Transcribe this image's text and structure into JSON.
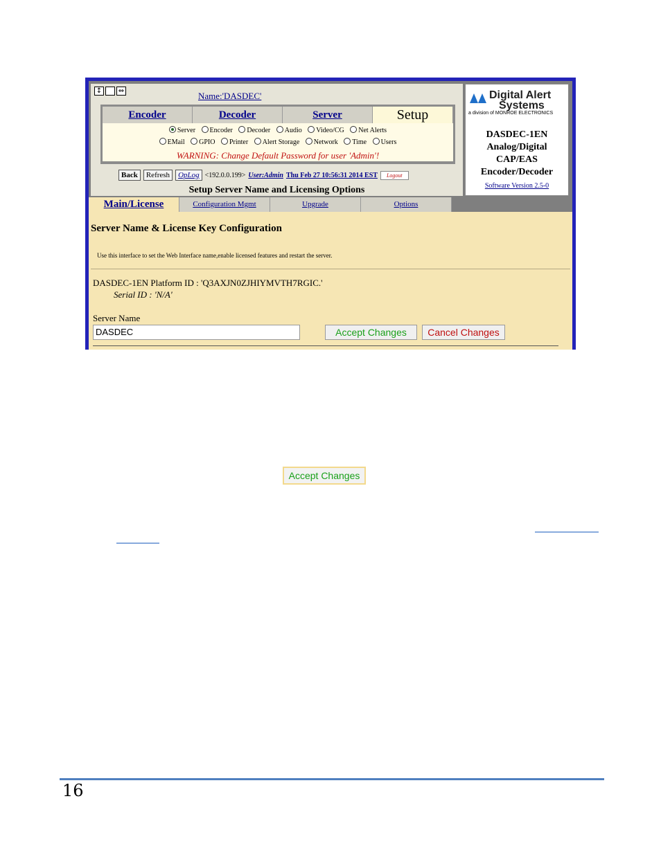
{
  "screenshot": {
    "window_icons": [
      "↕",
      "",
      "⇔"
    ],
    "name_link": "Name:'DASDEC'",
    "main_tabs": [
      {
        "label": "Encoder",
        "active": false
      },
      {
        "label": "Decoder",
        "active": false
      },
      {
        "label": "Server",
        "active": false
      },
      {
        "label": "Setup",
        "active": true
      }
    ],
    "radio_row1": [
      {
        "label": "Server",
        "selected": true
      },
      {
        "label": "Encoder",
        "selected": false
      },
      {
        "label": "Decoder",
        "selected": false
      },
      {
        "label": "Audio",
        "selected": false
      },
      {
        "label": "Video/CG",
        "selected": false
      },
      {
        "label": "Net Alerts",
        "selected": false
      }
    ],
    "radio_row2": [
      {
        "label": "EMail",
        "selected": false
      },
      {
        "label": "GPIO",
        "selected": false
      },
      {
        "label": "Printer",
        "selected": false
      },
      {
        "label": "Alert Storage",
        "selected": false
      },
      {
        "label": "Network",
        "selected": false
      },
      {
        "label": "Time",
        "selected": false
      },
      {
        "label": "Users",
        "selected": false
      }
    ],
    "warning": "WARNING: Change Default Password for user 'Admin'!",
    "toolbar": {
      "back": "Back",
      "refresh": "Refresh",
      "oplog": "OpLog",
      "ip": "<192.0.0.199>",
      "user": "User:Admin",
      "datetime": "Thu Feb 27 10:56:31 2014 EST",
      "logout": "Logout"
    },
    "section_title": "Setup Server Name and Licensing Options",
    "logo": {
      "brand_line1": "Digital Alert",
      "brand_line2": "Systems",
      "division": "a division of MONROE ELECTRONICS"
    },
    "product": {
      "line1": "DASDEC-1EN",
      "line2": "Analog/Digital",
      "line3": "CAP/EAS",
      "line4": "Encoder/Decoder"
    },
    "software_version": "Software Version 2.5-0",
    "sub_tabs": [
      {
        "label": "Main/License",
        "active": true
      },
      {
        "label": "Configuration Mgmt",
        "active": false
      },
      {
        "label": "Upgrade",
        "active": false
      },
      {
        "label": "Options",
        "active": false
      }
    ],
    "config_title": "Server Name & License Key Configuration",
    "config_desc": "Use this interface to set the Web Interface name,enable licensed features and restart the server.",
    "platform_id": "DASDEC-1EN Platform ID : 'Q3AXJN0ZJHIYMVTH7RGIC.'",
    "serial_id": "Serial ID : 'N/A'",
    "server_name_label": "Server Name",
    "server_name_value": "DASDEC",
    "accept_button": "Accept Changes",
    "cancel_button": "Cancel Changes",
    "colors": {
      "frame": "#2323b8",
      "panel": "#f6e6b4",
      "accept": "#1aa01a",
      "cancel": "#c01010"
    }
  },
  "document": {
    "accept_button": "Accept Changes",
    "page_number": "16",
    "footer_rule_color": "#4f7fbf"
  }
}
